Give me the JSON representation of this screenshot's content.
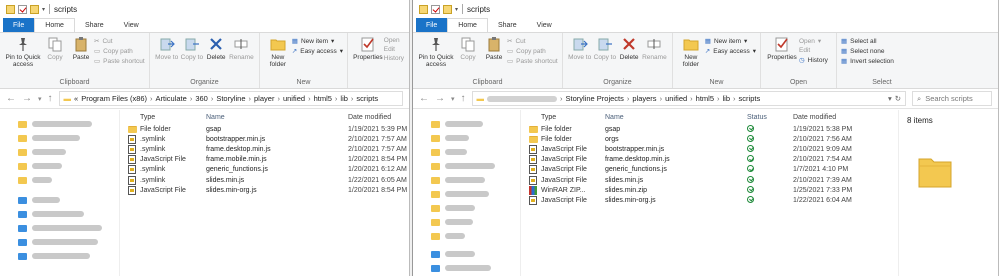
{
  "left_window": {
    "title": "scripts",
    "tabs": [
      "File",
      "Home",
      "Share",
      "View"
    ],
    "ribbon": {
      "clipboard": {
        "label": "Clipboard",
        "pin_label": "Pin to Quick access",
        "copy_label": "Copy",
        "paste_label": "Paste",
        "cut_label": "Cut",
        "copy_path_label": "Copy path",
        "paste_shortcut_label": "Paste shortcut"
      },
      "organize": {
        "label": "Organize",
        "move_label": "Move to",
        "copy_to_label": "Copy to",
        "delete_label": "Delete",
        "rename_label": "Rename"
      },
      "new": {
        "label": "New",
        "new_folder_label": "New folder",
        "new_item_label": "New item",
        "easy_access_label": "Easy access"
      },
      "open": {
        "properties_label": "Properties",
        "open_label": "Open",
        "edit_label": "Edit",
        "history_label": "History"
      }
    },
    "breadcrumb": [
      "«",
      "Program Files (x86)",
      "Articulate",
      "360",
      "Storyline",
      "player",
      "unified",
      "html5",
      "lib",
      "scripts"
    ],
    "columns": {
      "type": "Type",
      "name": "Name",
      "date": "Date modified"
    },
    "files": [
      {
        "icon": "folder-icon",
        "type": "File folder",
        "name": "gsap",
        "date": "1/19/2021 5:39 PM"
      },
      {
        "icon": "js-file-icon",
        "type": ".symlink",
        "name": "bootstrapper.min.js",
        "date": "2/10/2021 7:57 AM"
      },
      {
        "icon": "js-file-icon",
        "type": ".symlink",
        "name": "frame.desktop.min.js",
        "date": "2/10/2021 7:57 AM"
      },
      {
        "icon": "js-file-icon",
        "type": "JavaScript File",
        "name": "frame.mobile.min.js",
        "date": "1/20/2021 8:54 PM"
      },
      {
        "icon": "js-file-icon",
        "type": ".symlink",
        "name": "generic_functions.js",
        "date": "1/20/2021 6:12 AM"
      },
      {
        "icon": "js-file-icon",
        "type": ".symlink",
        "name": "slides.min.js",
        "date": "1/22/2021 6:05 AM"
      },
      {
        "icon": "js-file-icon",
        "type": "JavaScript File",
        "name": "slides.min-org.js",
        "date": "1/20/2021 8:54 PM"
      }
    ]
  },
  "right_window": {
    "title": "scripts",
    "tabs": [
      "File",
      "Home",
      "Share",
      "View"
    ],
    "ribbon": {
      "clipboard": {
        "label": "Clipboard",
        "pin_label": "Pin to Quick access",
        "copy_label": "Copy",
        "paste_label": "Paste",
        "cut_label": "Cut",
        "copy_path_label": "Copy path",
        "paste_shortcut_label": "Paste shortcut"
      },
      "organize": {
        "label": "Organize",
        "move_label": "Move to",
        "copy_to_label": "Copy to",
        "delete_label": "Delete",
        "rename_label": "Rename"
      },
      "new": {
        "label": "New",
        "new_folder_label": "New folder",
        "new_item_label": "New item",
        "easy_access_label": "Easy access"
      },
      "open": {
        "label": "Open",
        "properties_label": "Properties",
        "open_label": "Open",
        "edit_label": "Edit",
        "history_label": "History"
      },
      "select": {
        "label": "Select",
        "select_all_label": "Select all",
        "select_none_label": "Select none",
        "invert_label": "Invert selection"
      }
    },
    "breadcrumb": [
      "Storyline Projects",
      "players",
      "unified",
      "html5",
      "lib",
      "scripts"
    ],
    "search_placeholder": "Search scripts",
    "columns": {
      "type": "Type",
      "name": "Name",
      "status": "Status",
      "date": "Date modified"
    },
    "files": [
      {
        "icon": "folder-icon",
        "type": "File folder",
        "name": "gsap",
        "date": "1/19/2021 5:38 PM"
      },
      {
        "icon": "folder-icon",
        "type": "File folder",
        "name": "orgs",
        "date": "2/10/2021 7:56 AM"
      },
      {
        "icon": "js-file-icon",
        "type": "JavaScript File",
        "name": "bootstrapper.min.js",
        "date": "2/10/2021 9:09 AM"
      },
      {
        "icon": "js-file-icon",
        "type": "JavaScript File",
        "name": "frame.desktop.min.js",
        "date": "2/10/2021 7:54 AM"
      },
      {
        "icon": "js-file-icon",
        "type": "JavaScript File",
        "name": "generic_functions.js",
        "date": "1/7/2021 4:10 PM"
      },
      {
        "icon": "js-file-icon",
        "type": "JavaScript File",
        "name": "slides.min.js",
        "date": "2/10/2021 7:39 AM"
      },
      {
        "icon": "zip-file-icon",
        "type": "WinRAR ZIP...",
        "name": "slides.min.zip",
        "date": "1/25/2021 7:33 PM"
      },
      {
        "icon": "js-file-icon",
        "type": "JavaScript File",
        "name": "slides.min-org.js",
        "date": "1/22/2021 6:04 AM"
      }
    ],
    "item_count": "8 items"
  }
}
